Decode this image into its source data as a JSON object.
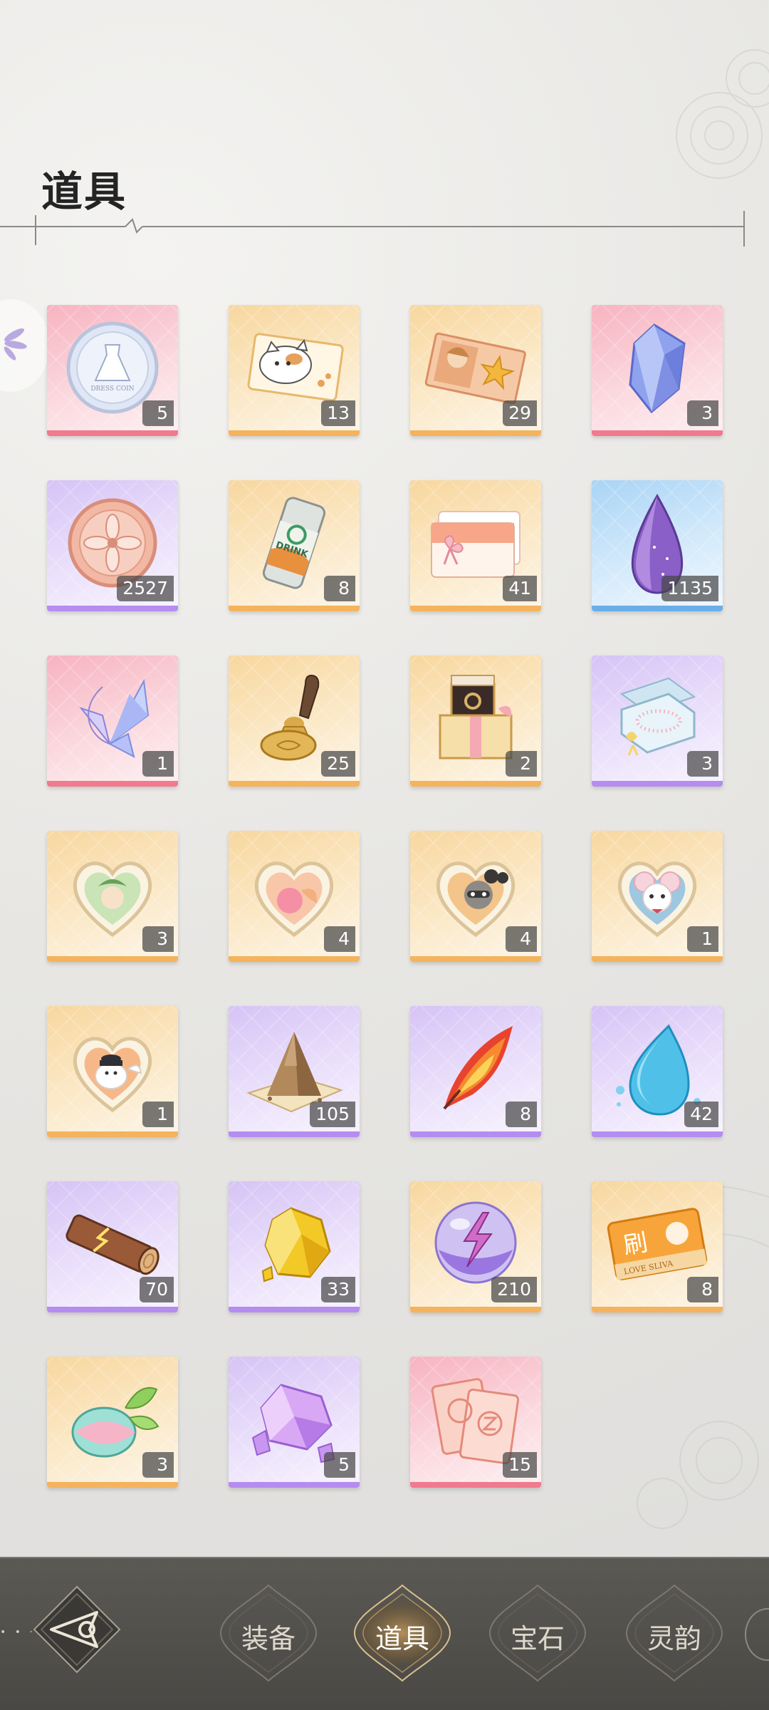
{
  "header": {
    "title": "道具"
  },
  "items": [
    {
      "icon": "dress-coin-icon",
      "count": "5",
      "quality": "pink"
    },
    {
      "icon": "cat-ticket-icon",
      "count": "13",
      "quality": "orange"
    },
    {
      "icon": "photo-card-icon",
      "count": "29",
      "quality": "orange"
    },
    {
      "icon": "blue-crystal-icon",
      "count": "3",
      "quality": "pink"
    },
    {
      "icon": "flower-coin-icon",
      "count": "2527",
      "quality": "purple"
    },
    {
      "icon": "drink-can-icon",
      "count": "8",
      "quality": "orange"
    },
    {
      "icon": "gift-card-icon",
      "count": "41",
      "quality": "orange"
    },
    {
      "icon": "purple-gem-icon",
      "count": "1135",
      "quality": "blue"
    },
    {
      "icon": "crystal-wing-icon",
      "count": "1",
      "quality": "pink"
    },
    {
      "icon": "wax-seal-icon",
      "count": "25",
      "quality": "orange"
    },
    {
      "icon": "ring-gift-box-icon",
      "count": "2",
      "quality": "orange"
    },
    {
      "icon": "pearl-necklace-box-icon",
      "count": "3",
      "quality": "purple"
    },
    {
      "icon": "heart-charm-green-icon",
      "count": "3",
      "quality": "orange"
    },
    {
      "icon": "heart-charm-pink-icon",
      "count": "4",
      "quality": "orange"
    },
    {
      "icon": "heart-charm-raccoon-icon",
      "count": "4",
      "quality": "orange"
    },
    {
      "icon": "heart-charm-mouse-icon",
      "count": "1",
      "quality": "orange"
    },
    {
      "icon": "heart-charm-bird-icon",
      "count": "1",
      "quality": "orange"
    },
    {
      "icon": "sand-pile-icon",
      "count": "105",
      "quality": "purple"
    },
    {
      "icon": "fire-feather-icon",
      "count": "8",
      "quality": "purple"
    },
    {
      "icon": "water-drop-icon",
      "count": "42",
      "quality": "purple"
    },
    {
      "icon": "lightning-wood-icon",
      "count": "70",
      "quality": "purple"
    },
    {
      "icon": "gold-ore-icon",
      "count": "33",
      "quality": "purple"
    },
    {
      "icon": "thunder-orb-icon",
      "count": "210",
      "quality": "orange"
    },
    {
      "icon": "refresh-ticket-icon",
      "count": "8",
      "quality": "orange"
    },
    {
      "icon": "seed-bud-icon",
      "count": "3",
      "quality": "orange"
    },
    {
      "icon": "purple-crystal-cluster-icon",
      "count": "5",
      "quality": "purple"
    },
    {
      "icon": "z-cards-icon",
      "count": "15",
      "quality": "pink"
    }
  ],
  "refresh_ticket_text": {
    "main": "刷",
    "sub": "LOVE SLIVA"
  },
  "drink_can_text": "DRINK",
  "dress_coin_text": "DRESS COIN",
  "tabs": [
    {
      "label": "装备",
      "active": false
    },
    {
      "label": "道具",
      "active": true
    },
    {
      "label": "宝石",
      "active": false
    },
    {
      "label": "灵韵",
      "active": false
    }
  ],
  "colors": {
    "pink_bar": "#f07a8e",
    "orange_bar": "#f4b35c",
    "purple_bar": "#b58cf0",
    "blue_bar": "#6aaee8",
    "nav_bg": "#4f4d49"
  }
}
